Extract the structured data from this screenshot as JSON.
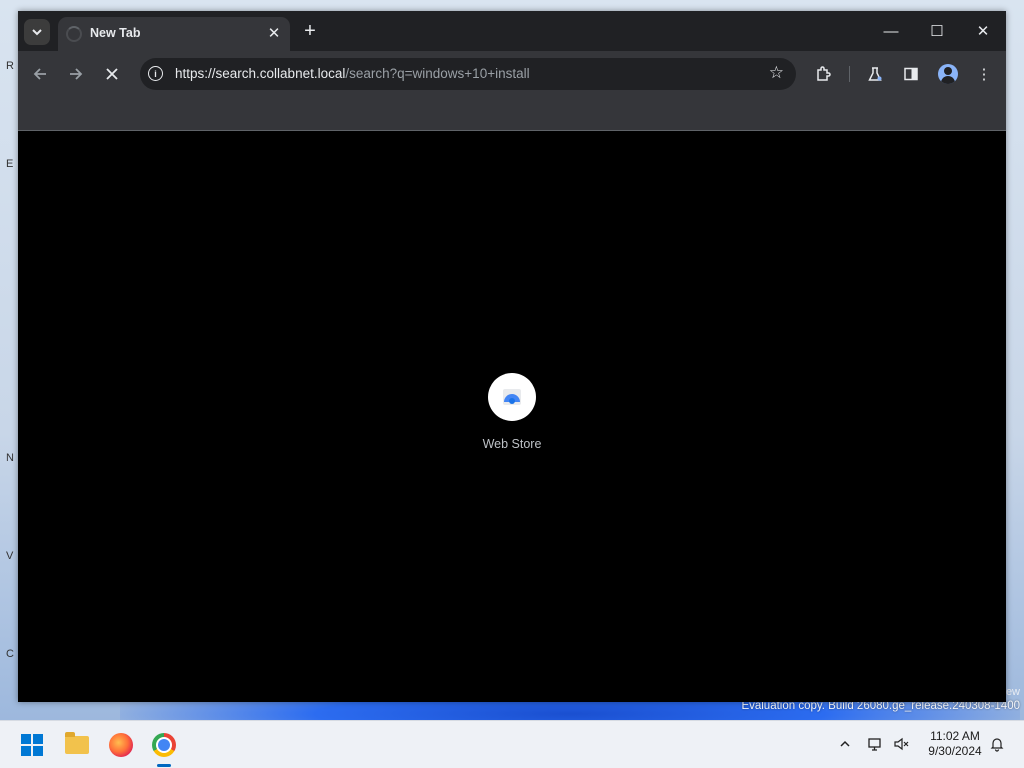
{
  "window": {
    "tab_title": "New Tab",
    "controls": {
      "minimize": "—",
      "maximize": "☐",
      "close": "✕"
    }
  },
  "toolbar": {
    "url_host": "https://search.collabnet.local",
    "url_path": "/search?q=windows+10+install",
    "loading": true
  },
  "new_tab_page": {
    "shortcuts": [
      {
        "label": "Web Store",
        "icon": "web-store-icon"
      }
    ]
  },
  "desktop": {
    "watermark_line1": "ew",
    "watermark_line2": "Evaluation copy. Build 26080.ge_release.240308-1400"
  },
  "taskbar": {
    "apps": [
      "start-icon",
      "file-explorer-icon",
      "firefox-icon",
      "chrome-icon"
    ],
    "active_app": "chrome-icon",
    "time": "11:02 AM",
    "date": "9/30/2024"
  },
  "colors": {
    "tabstrip": "#202124",
    "toolbar": "#35363a",
    "content": "#000000",
    "accent": "#0067c0"
  }
}
